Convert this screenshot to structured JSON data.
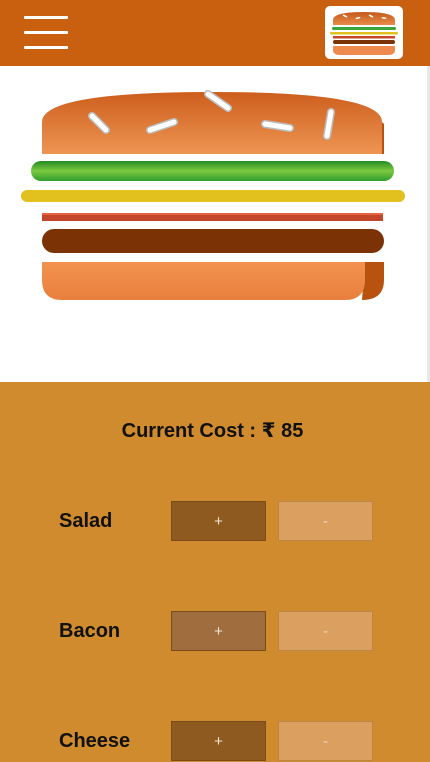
{
  "toolbar": {
    "menu_icon": "hamburger-menu-icon",
    "logo_icon": "burger-logo-icon",
    "background": "#c8600f"
  },
  "burger": {
    "layers": [
      "bread-top",
      "salad",
      "cheese",
      "bacon",
      "meat",
      "bread-bottom"
    ]
  },
  "build_controls": {
    "cost_text": "Current Cost : ₹ 85",
    "background": "#cf8b2d",
    "ingredients": [
      {
        "label": "Salad",
        "more_label": "+",
        "less_label": "-"
      },
      {
        "label": "Bacon",
        "more_label": "+",
        "less_label": "-"
      },
      {
        "label": "Cheese",
        "more_label": "+",
        "less_label": "-"
      }
    ]
  }
}
